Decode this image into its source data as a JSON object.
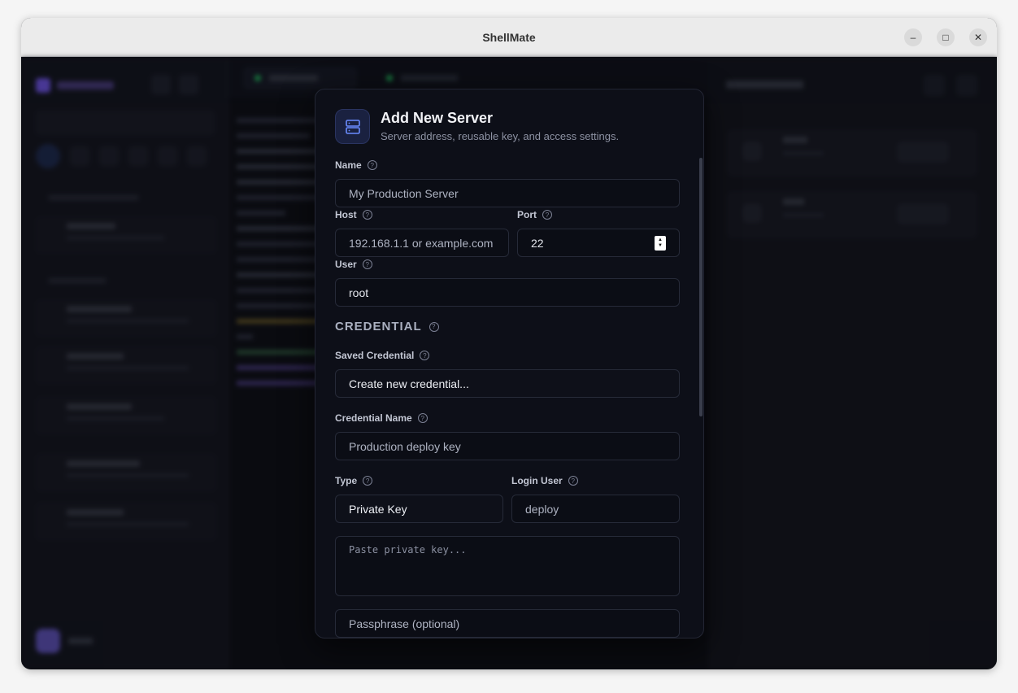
{
  "window": {
    "title": "ShellMate",
    "minimize_icon": "–",
    "maximize_icon": "□",
    "close_icon": "✕"
  },
  "modal": {
    "title": "Add New Server",
    "subtitle": "Server address, reusable key, and access settings.",
    "help_glyph": "?",
    "name": {
      "label": "Name",
      "placeholder": "My Production Server"
    },
    "host": {
      "label": "Host",
      "placeholder": "192.168.1.1 or example.com"
    },
    "port": {
      "label": "Port",
      "value": "22"
    },
    "user": {
      "label": "User",
      "value": "root"
    },
    "credential_section": "CREDENTIAL",
    "saved_credential": {
      "label": "Saved Credential",
      "value": "Create new credential..."
    },
    "credential_name": {
      "label": "Credential Name",
      "placeholder": "Production deploy key"
    },
    "type": {
      "label": "Type",
      "value": "Private Key"
    },
    "login_user": {
      "label": "Login User",
      "placeholder": "deploy"
    },
    "private_key": {
      "placeholder": "Paste private key..."
    },
    "passphrase": {
      "placeholder": "Passphrase (optional)"
    }
  },
  "colors": {
    "accent": "#4f7cff",
    "modal_bg": "#0d0f18",
    "status_green": "#22c55e"
  }
}
